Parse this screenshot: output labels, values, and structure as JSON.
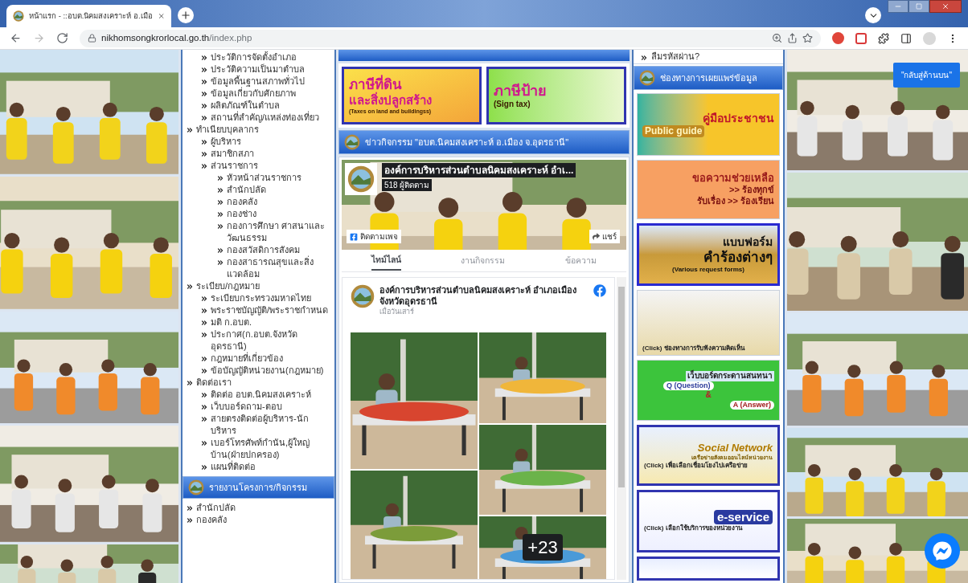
{
  "browser": {
    "tab_title": "หน้าแรก - ::อบต.นิคมสงเคราะห์ อ.เมือ",
    "url_host": "nikhomsongkrorlocal.go.th",
    "url_path": "/index.php"
  },
  "menu": {
    "groups": [
      {
        "children": [
          {
            "label": "ประวัติการจัดตั้งอำเภอ"
          },
          {
            "label": "ประวัติความเป็นมาตำบล"
          },
          {
            "label": "ข้อมูลพื้นฐานสภาพทั่วไป"
          },
          {
            "label": "ข้อมูลเกี่ยวกับศักยภาพ"
          },
          {
            "label": "ผลิตภัณฑ์ในตำบล"
          },
          {
            "label": "สถานที่สำคัญ/แหล่งท่องเที่ยว"
          }
        ]
      },
      {
        "label": "ทำเนียบบุคลากร",
        "children": [
          {
            "label": "ผู้บริหาร"
          },
          {
            "label": "สมาชิกสภา"
          },
          {
            "label": "ส่วนราชการ",
            "children": [
              {
                "label": "หัวหน้าส่วนราชการ"
              },
              {
                "label": "สำนักปลัด"
              },
              {
                "label": "กองคลัง"
              },
              {
                "label": "กองช่าง"
              },
              {
                "label": "กองการศึกษา ศาสนาและวัฒนธรรม"
              },
              {
                "label": "กองสวัสดิการสังคม"
              },
              {
                "label": "กองสาธารณสุขและสิ่งแวดล้อม"
              }
            ]
          }
        ]
      },
      {
        "label": "ระเบียบ/กฎหมาย",
        "children": [
          {
            "label": "ระเบียบกระทรวงมหาดไทย"
          },
          {
            "label": "พระราชบัญญัติ/พระราชกำหนด"
          },
          {
            "label": "มติ ก.อบต."
          },
          {
            "label": "ประกาศ(ก.อบต.จังหวัดอุดรธานี)"
          },
          {
            "label": "กฎหมายที่เกี่ยวข้อง"
          },
          {
            "label": "ข้อบัญญัติหน่วยงาน(กฎหมาย)"
          }
        ]
      },
      {
        "label": "ติดต่อเรา",
        "children": [
          {
            "label": "ติดต่อ อบต.นิคมสงเคราะห์"
          },
          {
            "label": "เว็บบอร์ดถาม-ตอบ"
          },
          {
            "label": "สายตรงติดต่อผู้บริหาร-นักบริหาร"
          },
          {
            "label": "เบอร์โทรศัพท์กำนัน,ผู้ใหญ่บ้าน(ฝ่ายปกครอง)"
          },
          {
            "label": "แผนที่ติดต่อ"
          }
        ]
      }
    ]
  },
  "report_panel": {
    "title": "รายงานโครงการ/กิจกรรม",
    "items": [
      {
        "label": "สำนักปลัด"
      },
      {
        "label": "กองคลัง"
      }
    ]
  },
  "top_banners": [
    {
      "kind": "land_tax",
      "lines": [
        "ภาษีที่ดิน",
        "และสิ่งปลูกสร้าง",
        "(Taxes on land and buildingss)"
      ]
    },
    {
      "kind": "sign_tax",
      "lines": [
        "ภาษีป้าย",
        "(Sign tax)"
      ]
    }
  ],
  "news_panel": {
    "title": "ข่าวกิจกรรม \"อบต.นิคมสงเคราะห์ อ.เมือง จ.อุดรธานี\"",
    "facebook": {
      "page_name": "องค์การบริหารส่วนตำบลนิคมสงเคราะห์ อำเ...",
      "followers": "518 ผู้ติดตาม",
      "follow_button": "ติดตามเพจ",
      "share_button": "แชร์",
      "tabs": [
        {
          "label": "ไทม์ไลน์",
          "selected": true
        },
        {
          "label": "งานกิจกรรม",
          "selected": false
        },
        {
          "label": "ข้อความ",
          "selected": false
        }
      ],
      "post": {
        "author": "องค์การบริหารส่วนตำบลนิคมสงเคราะห์ อำเภอเมือง จังหวัดอุดรธานี",
        "time": "เมื่อวันเสาร์",
        "more_photos": "+23"
      }
    }
  },
  "sidebar": {
    "forgot_password": "ลืมรหัสผ่าน?",
    "title": "ช่องทางการเผยแพร่ข้อมูล",
    "banners": [
      {
        "kind": "guide",
        "lines": [
          "คู่มือประชาชน",
          "Public guide"
        ]
      },
      {
        "kind": "help",
        "lines": [
          "ขอความช่วยเหลือ",
          ">> ร้องทุกข์",
          "รับเรื่อง >> ร้องเรียน"
        ]
      },
      {
        "kind": "forms",
        "lines": [
          "แบบฟอร์ม",
          "คำร้องต่างๆ",
          "(Various request forms)"
        ]
      },
      {
        "kind": "comments",
        "lines": [
          "(Click) ช่องทางการรับฟังความคิดเห็น"
        ]
      },
      {
        "kind": "qa",
        "lines": [
          "เว็บบอร์ดกระดานสนทนา",
          "Q (Question)",
          "&",
          "A (Answer)"
        ]
      },
      {
        "kind": "social",
        "lines": [
          "Social Network",
          "เครือข่ายสังคมออนไลน์หน่วยงาน",
          "(Click) เพื่อเลือกเชื่อมโยงไปเครือข่าย"
        ]
      },
      {
        "kind": "eservice",
        "lines": [
          "e-service",
          "(Click) เลือกใช้บริการของหน่วยงาน"
        ]
      },
      {
        "kind": "news"
      }
    ]
  },
  "back_to_top": "\"กลับสู่ด้านบน\""
}
